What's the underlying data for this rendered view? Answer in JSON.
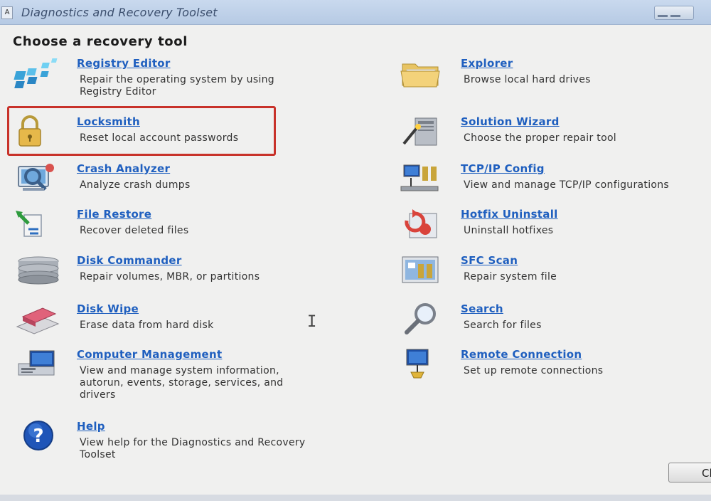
{
  "window": {
    "title": "Diagnostics and Recovery Toolset",
    "icon_letter": "A"
  },
  "heading": "Choose a recovery tool",
  "left_tools": [
    {
      "name": "Registry Editor",
      "desc1": "Repair the operating system by using",
      "desc2": "Registry Editor",
      "icon": "registry-editor-icon"
    },
    {
      "name": "Locksmith",
      "desc1": "Reset local account passwords",
      "desc2": "",
      "icon": "padlock-icon"
    },
    {
      "name": "Crash Analyzer",
      "desc1": "Analyze crash dumps",
      "desc2": "",
      "icon": "crash-analyzer-icon"
    },
    {
      "name": "File Restore",
      "desc1": "Recover deleted files",
      "desc2": "",
      "icon": "file-restore-icon"
    },
    {
      "name": "Disk Commander",
      "desc1": "Repair volumes, MBR, or partitions",
      "desc2": "",
      "icon": "disk-stack-icon"
    },
    {
      "name": "Disk Wipe",
      "desc1": "Erase data from hard disk",
      "desc2": "",
      "icon": "eraser-icon"
    },
    {
      "name": "Computer Management",
      "desc1": "View and manage system information,",
      "desc2": "autorun, events, storage, services, and",
      "desc3": "drivers",
      "icon": "computer-management-icon"
    },
    {
      "name": "Help",
      "desc1": "View help for the Diagnostics and Recovery",
      "desc2": "Toolset",
      "icon": "help-icon"
    }
  ],
  "right_tools": [
    {
      "name": "Explorer",
      "desc1": "Browse local hard drives",
      "icon": "folder-icon"
    },
    {
      "name": "Solution Wizard",
      "desc1": "Choose the proper repair tool",
      "icon": "wizard-icon"
    },
    {
      "name": "TCP/IP Config",
      "desc1": "View and manage TCP/IP configurations",
      "icon": "network-config-icon"
    },
    {
      "name": "Hotfix Uninstall",
      "desc1": "Uninstall hotfixes",
      "icon": "hotfix-uninstall-icon"
    },
    {
      "name": "SFC Scan",
      "desc1": "Repair system file",
      "icon": "sfc-scan-icon"
    },
    {
      "name": "Search",
      "desc1": "Search for files",
      "icon": "magnifier-icon"
    },
    {
      "name": "Remote Connection",
      "desc1": "Set up remote connections",
      "icon": "remote-connection-icon"
    }
  ],
  "close_button": "Cl",
  "colors": {
    "link": "#1f5fbf",
    "highlight": "#c8322a",
    "titlebar": "#c9d9ee"
  }
}
